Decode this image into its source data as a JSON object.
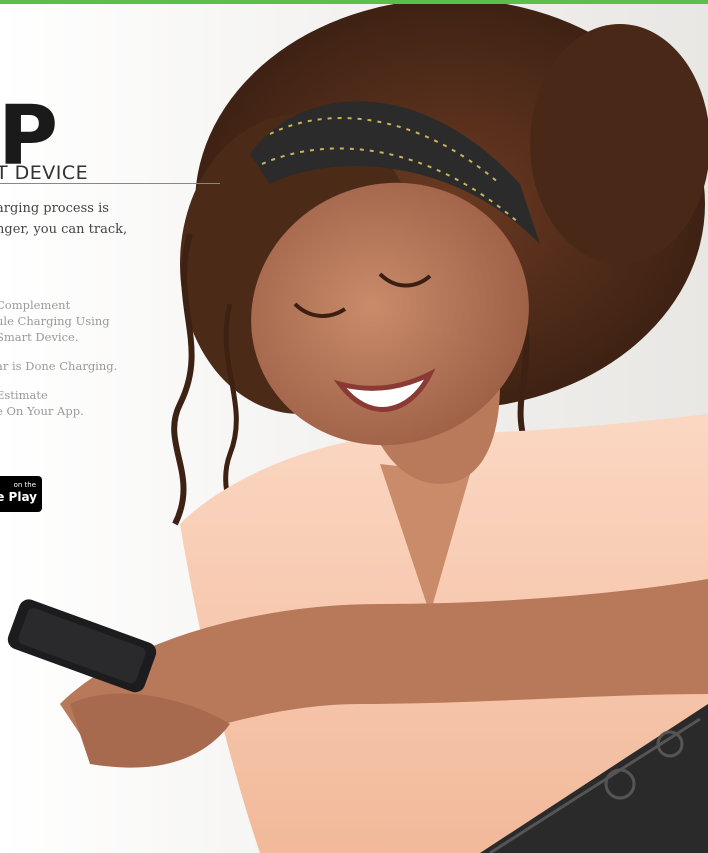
{
  "headline": "P",
  "subhead": "T DEVICE",
  "intro": [
    "arging process is",
    "nger, you can track,"
  ],
  "features": [
    [
      "Complement",
      "ule Charging Using",
      "Smart Device."
    ],
    [
      "ar is Done Charging."
    ],
    [
      "Estimate",
      "e On Your App."
    ]
  ],
  "store_badge": {
    "small": "on the",
    "big": "e Play"
  },
  "colors": {
    "accent_bar": "#5cbf4a",
    "badge_bg": "#000000"
  }
}
